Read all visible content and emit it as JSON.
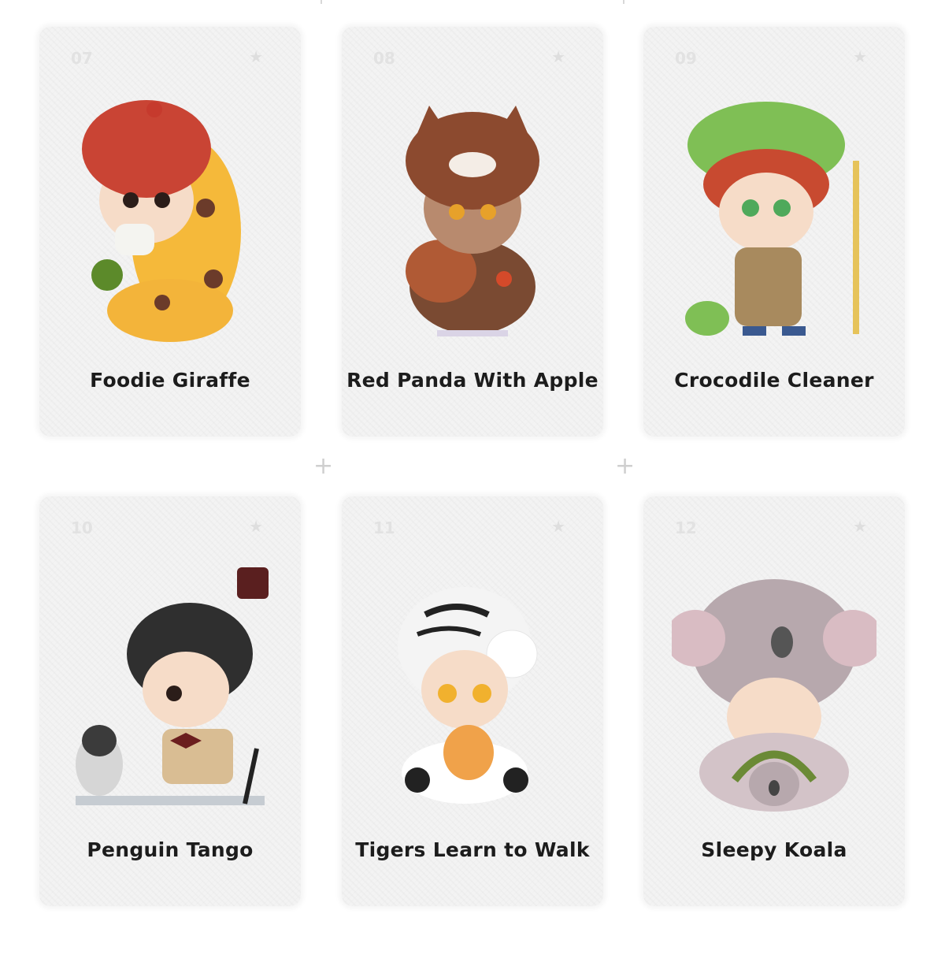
{
  "cards": [
    {
      "number": "07",
      "name": "Foodie Giraffe"
    },
    {
      "number": "08",
      "name": "Red Panda With Apple"
    },
    {
      "number": "09",
      "name": "Crocodile Cleaner"
    },
    {
      "number": "10",
      "name": "Penguin Tango"
    },
    {
      "number": "11",
      "name": "Tigers Learn to Walk"
    },
    {
      "number": "12",
      "name": "Sleepy Koala"
    }
  ],
  "icons": {
    "star": "star-icon",
    "plus": "plus-icon"
  },
  "colors": {
    "card_bg": "#f3f3f3",
    "title": "#1c1c1c",
    "number": "#e2e2e2"
  }
}
